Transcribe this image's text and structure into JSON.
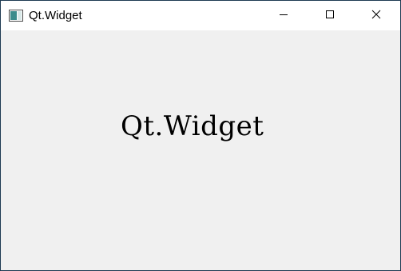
{
  "window": {
    "title": "Qt.Widget",
    "icon": "app-window-icon",
    "buttons": {
      "minimize": "minimize-icon",
      "maximize": "maximize-icon",
      "close": "close-icon"
    }
  },
  "content": {
    "label": "Qt.Widget"
  },
  "colors": {
    "client_bg": "#f0f0f0",
    "titlebar_bg": "#ffffff",
    "border": "#1e3a52"
  }
}
